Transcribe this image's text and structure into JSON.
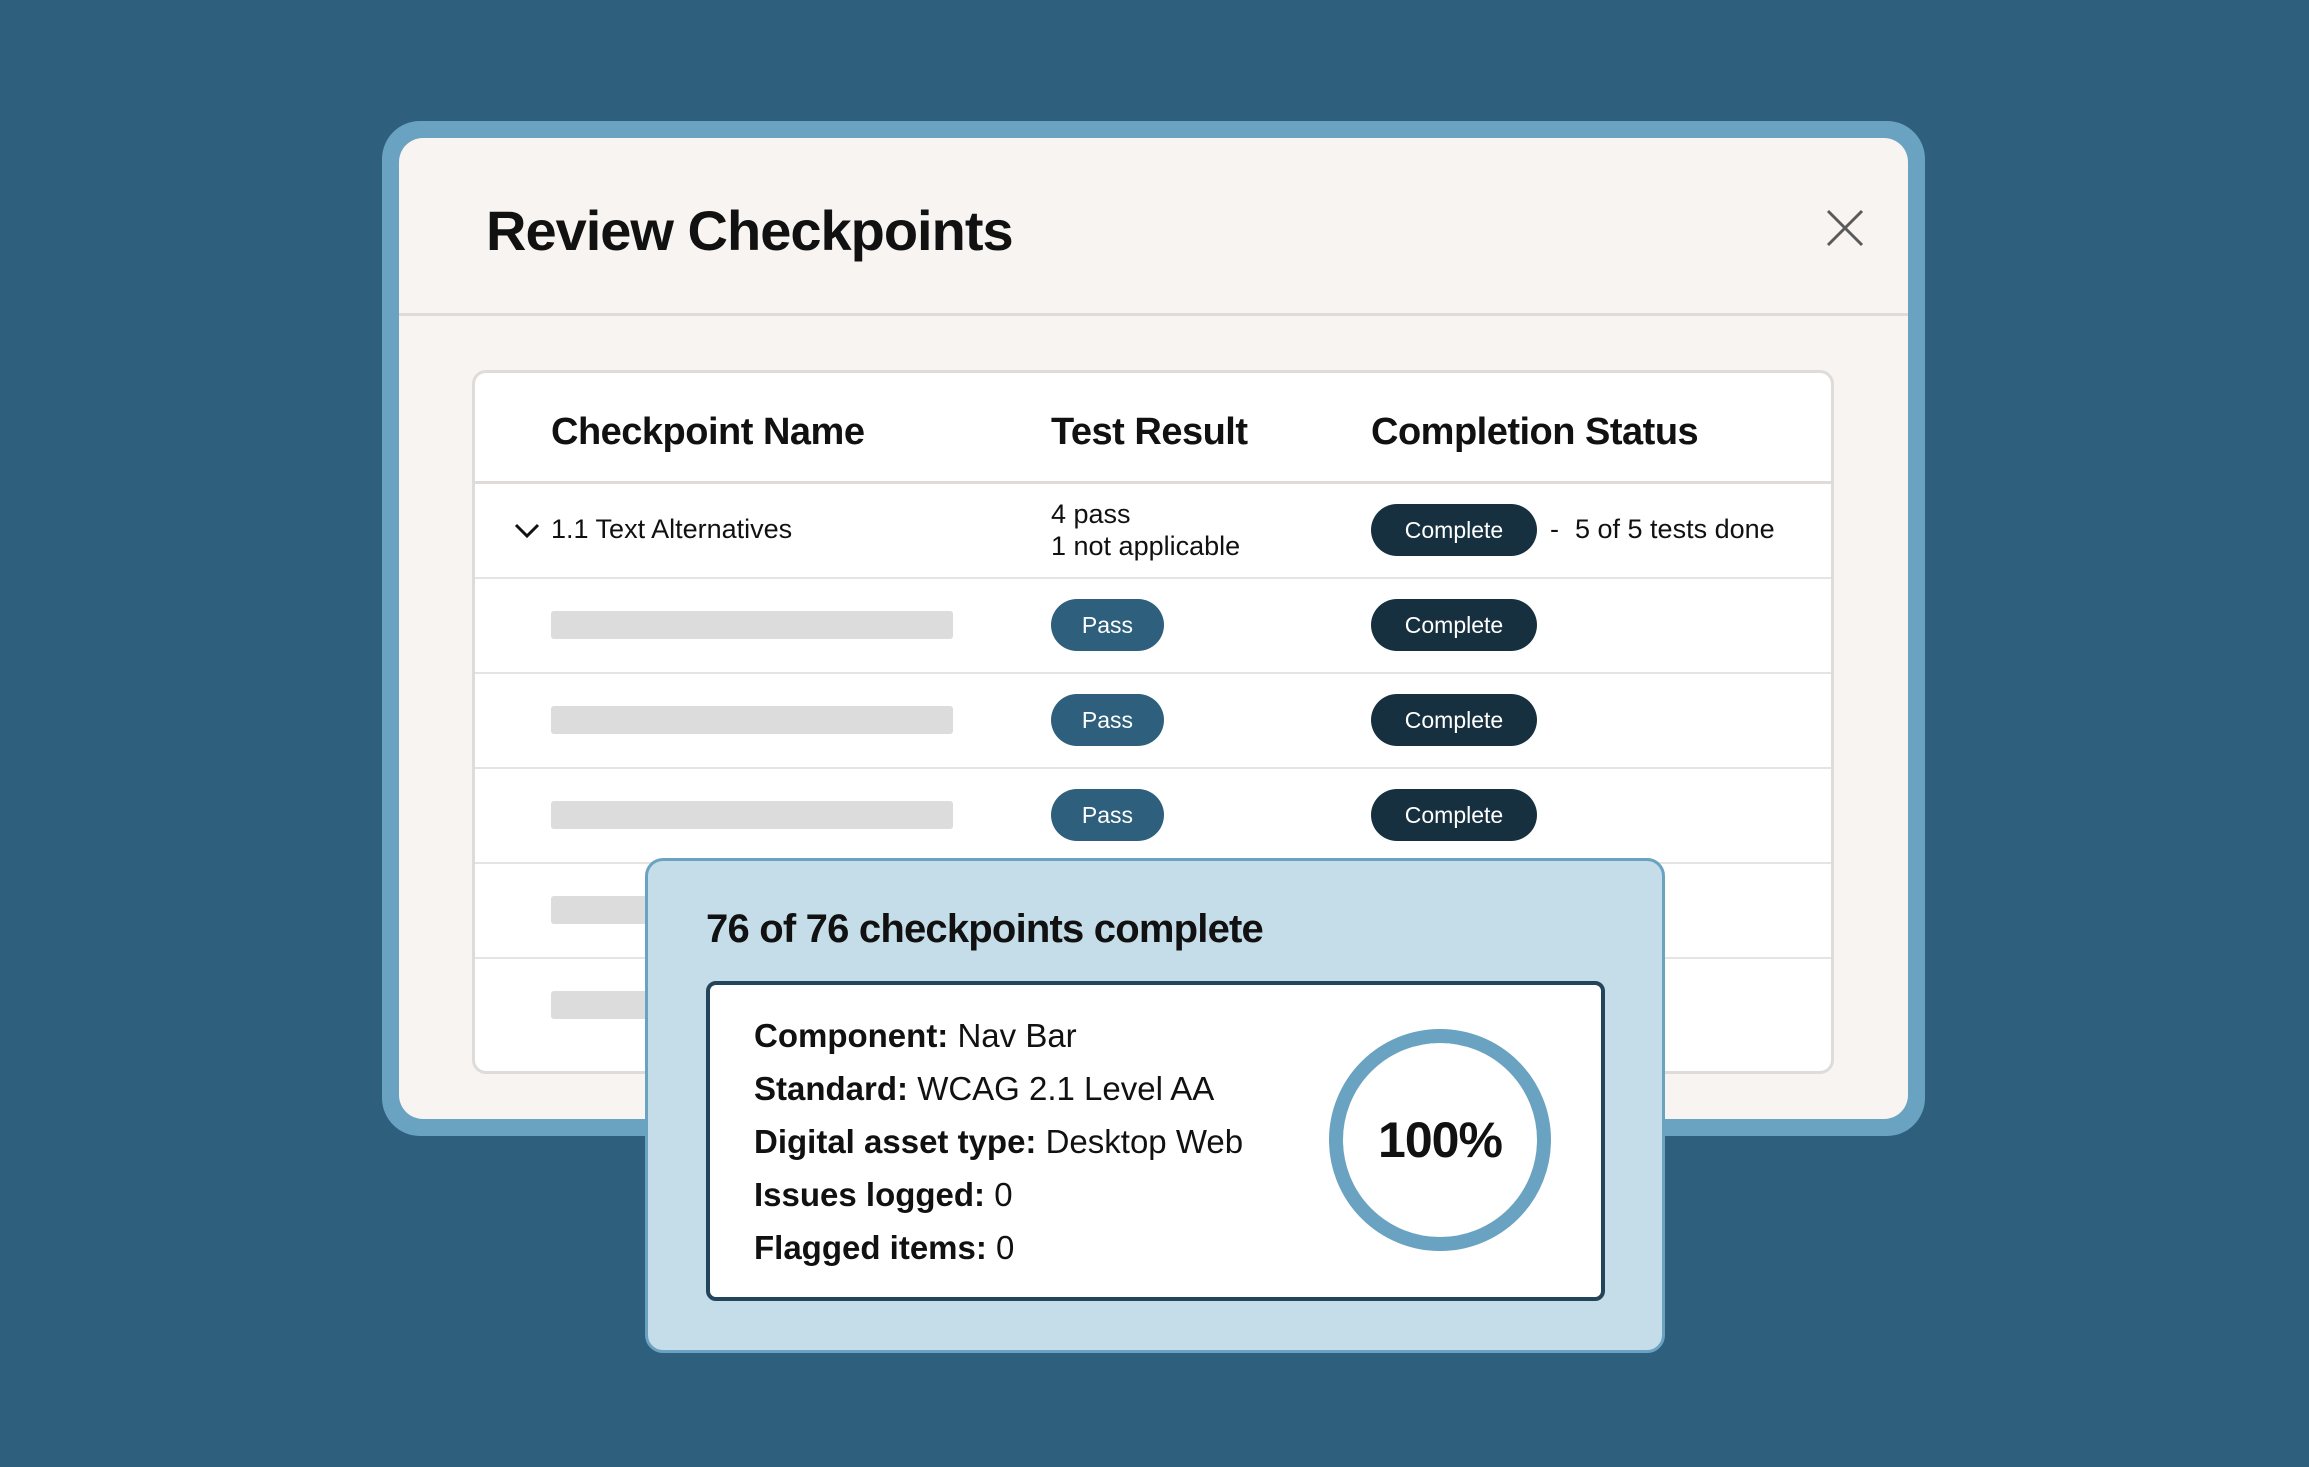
{
  "modal": {
    "title": "Review Checkpoints",
    "close_icon": "close-icon"
  },
  "table": {
    "columns": [
      "Checkpoint Name",
      "Test Result",
      "Completion Status"
    ],
    "group": {
      "name": "1.1 Text Alternatives",
      "icon": "chevron-down-icon",
      "result_lines": [
        "4 pass",
        "1 not applicable"
      ],
      "status": "Complete",
      "status_separator": "-",
      "status_detail": "5 of 5 tests done"
    },
    "rows": [
      {
        "result": "Pass",
        "status": "Complete"
      },
      {
        "result": "Pass",
        "status": "Complete"
      },
      {
        "result": "Pass",
        "status": "Complete"
      }
    ]
  },
  "summary": {
    "title": "76 of 76 checkpoints complete",
    "details": [
      {
        "label": "Component:",
        "value": "Nav Bar"
      },
      {
        "label": "Standard:",
        "value": "WCAG 2.1 Level AA"
      },
      {
        "label": "Digital asset type:",
        "value": "Desktop Web"
      },
      {
        "label": "Issues logged:",
        "value": "0"
      },
      {
        "label": "Flagged items:",
        "value": "0"
      }
    ],
    "progress_percent": 100,
    "progress_label": "100%"
  },
  "colors": {
    "background": "#2e5f7c",
    "frame": "#6aa3c1",
    "badge_complete": "#17303f",
    "badge_pass": "#2e5f7c",
    "summary_bg": "#c5dde9",
    "ring": "#6aa3c1"
  }
}
